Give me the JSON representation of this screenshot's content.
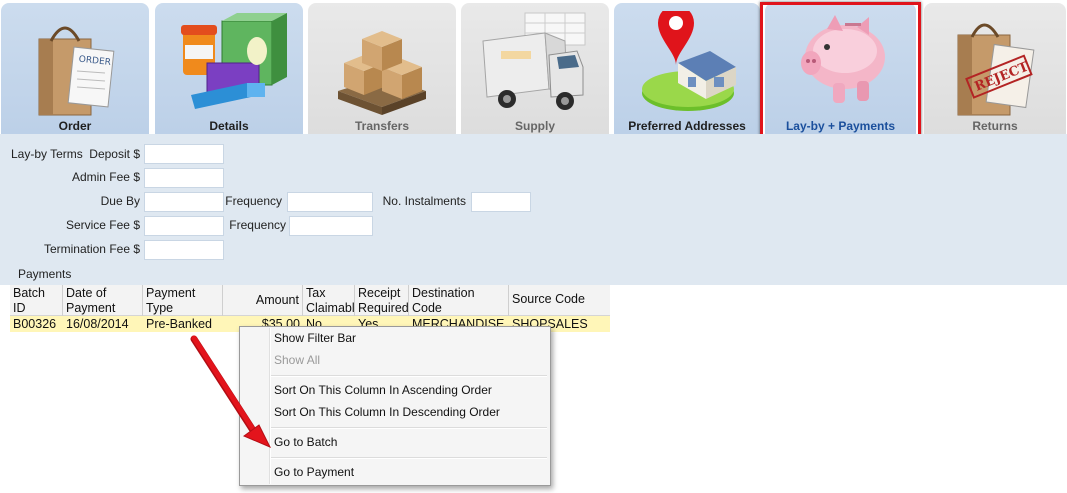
{
  "tabs": [
    {
      "label": "Order",
      "icon": "shopping-bag-order-icon"
    },
    {
      "label": "Details",
      "icon": "products-icon"
    },
    {
      "label": "Transfers",
      "icon": "boxes-pallet-icon"
    },
    {
      "label": "Supply",
      "icon": "delivery-truck-icon"
    },
    {
      "label": "Preferred Addresses",
      "icon": "map-pin-house-icon"
    },
    {
      "label": "Lay-by + Payments",
      "icon": "piggy-bank-icon"
    },
    {
      "label": "Returns",
      "icon": "rejected-bag-icon"
    }
  ],
  "form": {
    "layby_terms": "Lay-by Terms",
    "deposit_label": "Deposit $",
    "admin_fee_label": "Admin Fee $",
    "due_by_label": "Due By",
    "frequency_label": "Frequency",
    "no_instalments_label": "No. Instalments",
    "service_fee_label": "Service Fee $",
    "termination_fee_label": "Termination Fee $",
    "payments_label": "Payments"
  },
  "payments_grid": {
    "columns": [
      "Batch ID",
      "Date of Payment",
      "Payment Type",
      "Amount",
      "Tax Claimable",
      "Receipt Required",
      "Destination Code",
      "Source Code"
    ],
    "rows": [
      [
        "B00326",
        "16/08/2014",
        "Pre-Banked",
        "$35.00",
        "No",
        "Yes",
        "MERCHANDISE",
        "SHOPSALES"
      ]
    ]
  },
  "context_menu": {
    "items": [
      "Show Filter Bar",
      "Show All",
      "Sort On This Column In Ascending Order",
      "Sort On This Column In Descending Order",
      "Go to Batch",
      "Go to Payment"
    ]
  },
  "colors": {
    "accent": "#1b4f9c",
    "highlight": "#e0141b",
    "selected_row": "#fff6b8"
  }
}
